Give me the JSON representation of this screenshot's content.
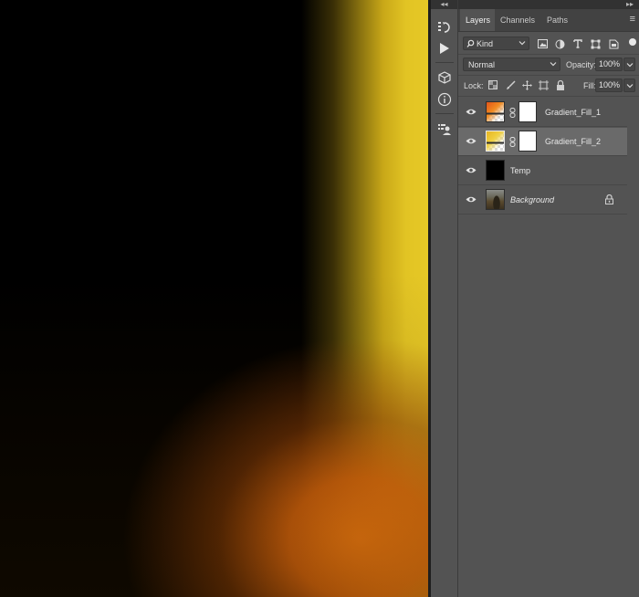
{
  "panel": {
    "tabs": [
      "Layers",
      "Channels",
      "Paths"
    ],
    "active_tab": "Layers",
    "filter": {
      "label": "Kind"
    },
    "blend_mode": "Normal",
    "opacity_label": "Opacity:",
    "opacity_value": "100%",
    "lock_label": "Lock:",
    "fill_label": "Fill:",
    "fill_value": "100%"
  },
  "layers": [
    {
      "name": "Gradient_Fill_1",
      "thumb": "gradient-orange",
      "has_mask": true,
      "selected": false,
      "italic": false,
      "locked": false
    },
    {
      "name": "Gradient_Fill_2",
      "thumb": "gradient-yellow",
      "has_mask": true,
      "selected": true,
      "italic": false,
      "locked": false
    },
    {
      "name": "Temp",
      "thumb": "black",
      "has_mask": false,
      "selected": false,
      "italic": false,
      "locked": false
    },
    {
      "name": "Background",
      "thumb": "photo",
      "has_mask": false,
      "selected": false,
      "italic": true,
      "locked": true
    }
  ],
  "colors": {
    "panel_bg": "#535353",
    "selected_row": "#6a6a6a",
    "canvas_orange": "#e87610",
    "canvas_yellow": "#e6c826"
  },
  "icons": {
    "tool_strip": [
      "history-icon",
      "play-actions-icon",
      "cube-3d-icon",
      "info-icon",
      "properties-icon"
    ],
    "filter_kinds": [
      "image-filter-icon",
      "adjustment-filter-icon",
      "type-filter-icon",
      "shape-filter-icon",
      "smart-object-filter-icon"
    ],
    "locks": [
      "lock-transparent-icon",
      "lock-paint-icon",
      "lock-move-icon",
      "lock-artboard-icon",
      "lock-all-icon"
    ]
  }
}
